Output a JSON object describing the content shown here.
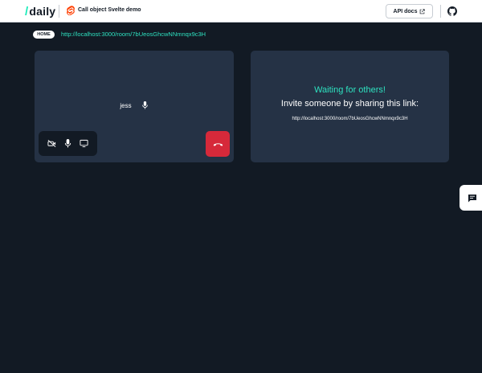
{
  "header": {
    "logo_slash": "/",
    "logo_text": "daily",
    "app_title": "Call object Svelte demo",
    "api_docs_label": "API docs",
    "icons": [
      "svelte-icon",
      "external-link-icon",
      "github-icon"
    ]
  },
  "breadcrumb": {
    "home_label": "HOME",
    "room_url": "http://localhost:3000/room/7bUeosGhcwNNmnqx9c3H"
  },
  "local_tile": {
    "participant_name": "jess",
    "icons": [
      "microphone-icon"
    ]
  },
  "controls": {
    "icons": [
      "camera-off-icon",
      "microphone-icon",
      "screen-share-icon"
    ],
    "leave_icon": "phone-hangup-icon"
  },
  "invite": {
    "title": "Waiting for others!",
    "text": "Invite someone by sharing this link:",
    "link": "http://localhost:3000/room/7bUeosGhcwNNmnqx9c3H"
  },
  "chat": {
    "icon": "chat-icon"
  },
  "colors": {
    "background": "#121a24",
    "tile": "#253245",
    "accent": "#2ee2c0",
    "leave": "#d6293a"
  }
}
